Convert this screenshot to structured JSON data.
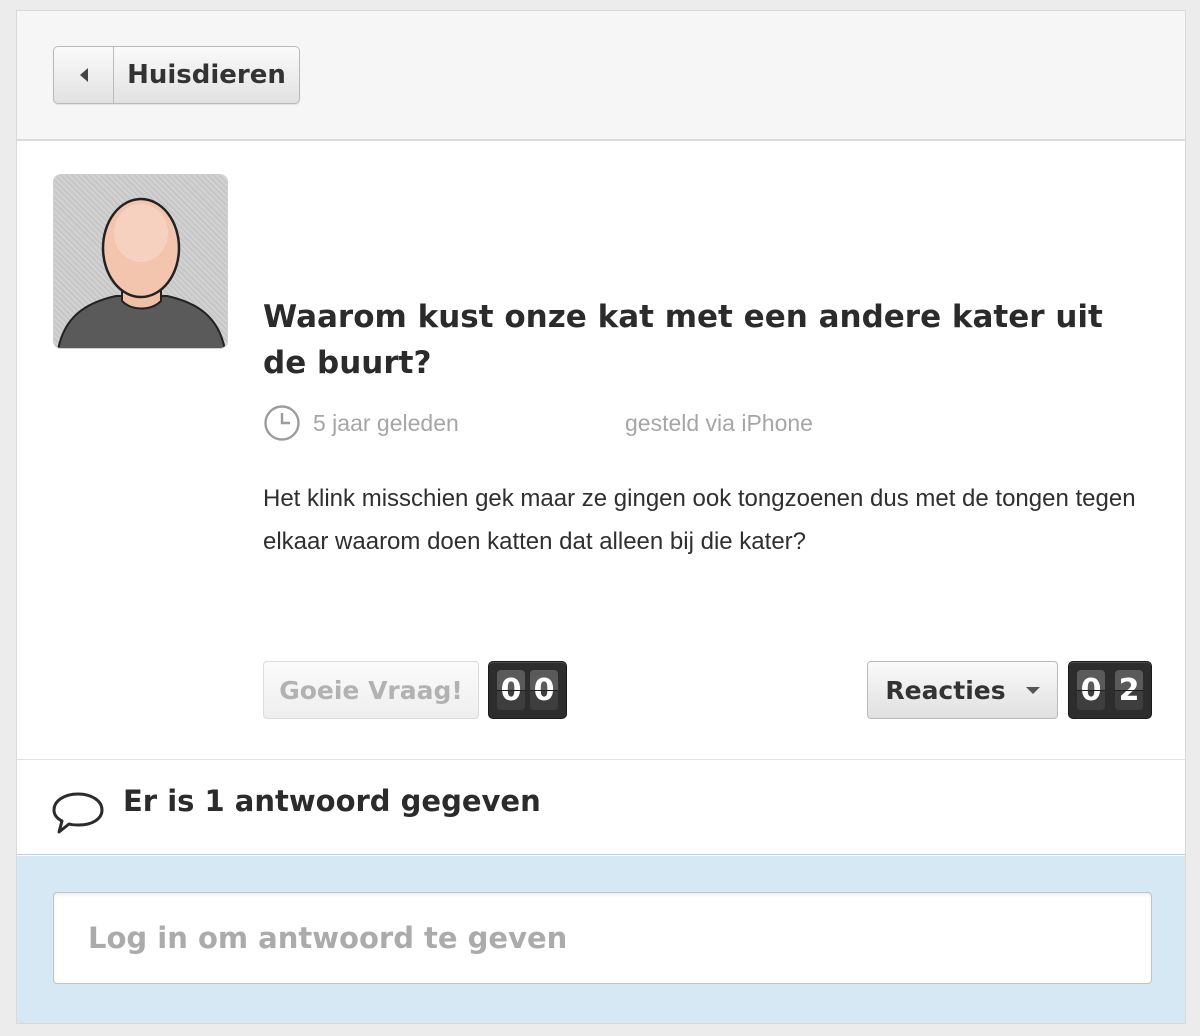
{
  "nav": {
    "back_label": "Huisdieren"
  },
  "question": {
    "title": "Waarom kust onze kat met een andere kater uit de buurt?",
    "time_ago": "5 jaar geleden",
    "source": "gesteld via iPhone",
    "body": "Het klink misschien gek maar ze gingen ook tongzoenen dus met de tongen tegen elkaar waarom doen katten dat alleen bij die kater?",
    "good_question_label": "Goeie Vraag!",
    "good_question_digits": [
      "0",
      "0"
    ],
    "reactions_label": "Reacties",
    "reactions_digits": [
      "0",
      "2"
    ]
  },
  "answers": {
    "count_text": "Er is 1 antwoord gegeven",
    "input_placeholder": "Log in om antwoord te geven"
  },
  "icons": {
    "back": "chevron-left-icon",
    "avatar": "user-silhouette-icon",
    "clock": "clock-icon",
    "dropdown": "caret-down-icon",
    "answers": "speech-bubble-icon"
  },
  "colors": {
    "answer_zone_bg": "#d5e8f3",
    "counter_bg": "#2d2d2d",
    "muted_text": "#a6a6a6"
  }
}
